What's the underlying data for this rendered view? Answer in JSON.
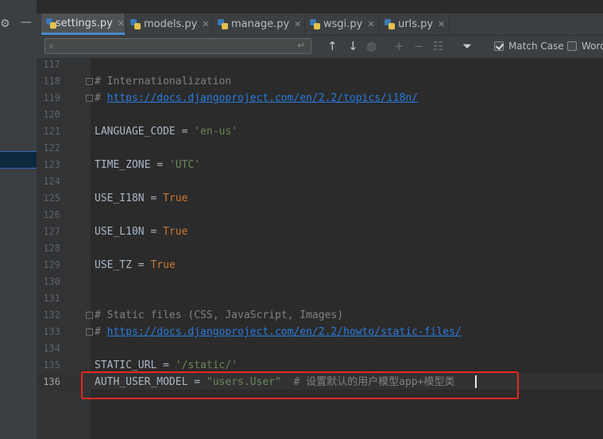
{
  "tabs": [
    {
      "label": "settings.py",
      "active": true
    },
    {
      "label": "models.py",
      "active": false
    },
    {
      "label": "manage.py",
      "active": false
    },
    {
      "label": "wsgi.py",
      "active": false
    },
    {
      "label": "urls.py",
      "active": false
    }
  ],
  "search": {
    "value": "",
    "match_case_label": "Match Case",
    "words_label": "Words",
    "match_case_checked": true,
    "words_checked": false
  },
  "editor": {
    "current_line": "136",
    "lines": [
      {
        "num": "117",
        "text": ""
      },
      {
        "num": "118",
        "text": "# Internationalization"
      },
      {
        "num": "119",
        "text": "# https://docs.djangoproject.com/en/2.2/topics/i18n/"
      },
      {
        "num": "120",
        "text": ""
      },
      {
        "num": "121",
        "text": "LANGUAGE_CODE = 'en-us'"
      },
      {
        "num": "122",
        "text": ""
      },
      {
        "num": "123",
        "text": "TIME_ZONE = 'UTC'"
      },
      {
        "num": "124",
        "text": ""
      },
      {
        "num": "125",
        "text": "USE_I18N = True"
      },
      {
        "num": "126",
        "text": ""
      },
      {
        "num": "127",
        "text": "USE_L10N = True"
      },
      {
        "num": "128",
        "text": ""
      },
      {
        "num": "129",
        "text": "USE_TZ = True"
      },
      {
        "num": "130",
        "text": ""
      },
      {
        "num": "131",
        "text": ""
      },
      {
        "num": "132",
        "text": "# Static files (CSS, JavaScript, Images)"
      },
      {
        "num": "133",
        "text": "# https://docs.djangoproject.com/en/2.2/howto/static-files/"
      },
      {
        "num": "134",
        "text": ""
      },
      {
        "num": "135",
        "text": "STATIC_URL = '/static/'"
      },
      {
        "num": "136",
        "text": "AUTH_USER_MODEL = \"users.User\"  # 设置默认的用户模型app+模型类"
      }
    ],
    "tokens": {
      "l118_comment": "# Internationalization",
      "l119_hash": "# ",
      "l119_link": "https://docs.djangoproject.com/en/2.2/topics/i18n/",
      "l121_var": "LANGUAGE_CODE",
      "l121_str": "'en-us'",
      "l123_var": "TIME_ZONE",
      "l123_str": "'UTC'",
      "l125_var": "USE_I18N",
      "l127_var": "USE_L10N",
      "l129_var": "USE_TZ",
      "kw_true": "True",
      "op_eq": " = ",
      "l132_comment": "# Static files (CSS, JavaScript, Images)",
      "l133_hash": "# ",
      "l133_link": "https://docs.djangoproject.com/en/2.2/howto/static-files/",
      "l135_var": "STATIC_URL",
      "l135_str": "'/static/'",
      "l136_var": "AUTH_USER_MODEL",
      "l136_str": "\"users.User\"",
      "l136_comment": "  # 设置默认的用户模型app+模型类"
    }
  },
  "colors": {
    "accent_tab_underline": "#4a88c7",
    "highlight_box": "#e8261f",
    "string": "#6a8759",
    "keyword": "#cc7832",
    "comment": "#808080",
    "link": "#287bde"
  }
}
